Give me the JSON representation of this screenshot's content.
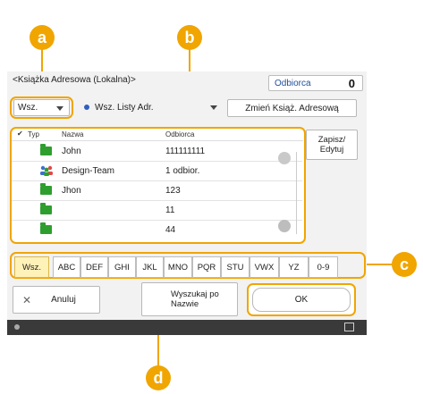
{
  "header": {
    "title": "<Książka Adresowa (Lokalna)>",
    "recipient_label": "Odbiorca",
    "recipient_count": "0"
  },
  "filters": {
    "type_value": "Wsz.",
    "list_value": "Wsz. Listy Adr.",
    "change_book_label": "Zmień Książ. Adresową"
  },
  "table": {
    "columns": {
      "check": "✔",
      "type": "Typ",
      "name": "Nazwa",
      "recipient": "Odbiorca"
    },
    "rows": [
      {
        "icon": "folder-icon",
        "name": "John",
        "recipient": "111111111"
      },
      {
        "icon": "group-icon",
        "name": "Design-Team",
        "recipient": "1 odbior."
      },
      {
        "icon": "folder-icon",
        "name": "Jhon",
        "recipient": "123"
      },
      {
        "icon": "folder-icon",
        "name": "",
        "recipient": "11"
      },
      {
        "icon": "folder-icon",
        "name": "",
        "recipient": "44"
      }
    ]
  },
  "side": {
    "save_edit_label": "Zapisz/ Edytuj"
  },
  "index_tabs": [
    "Wsz.",
    "ABC",
    "DEF",
    "GHI",
    "JKL",
    "MNO",
    "PQR",
    "STU",
    "VWX",
    "YZ",
    "0-9"
  ],
  "footer": {
    "cancel_label": "Anuluj",
    "search_label": "Wyszukaj po Nazwie",
    "ok_label": "OK"
  },
  "callouts": {
    "a": "a",
    "b": "b",
    "c": "c",
    "d": "d"
  },
  "colors": {
    "accent": "#f0a500",
    "status_bar": "#3a3a3a",
    "folder": "#2e9e2e",
    "group": "#3b6fd6"
  }
}
